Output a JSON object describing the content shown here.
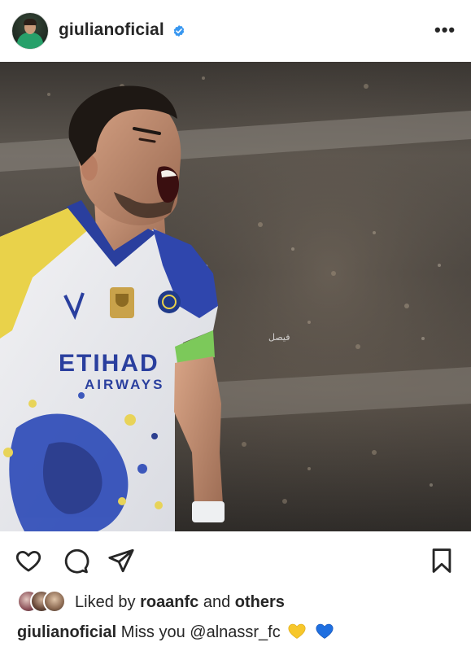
{
  "post": {
    "username": "giulianoficial",
    "verified": true,
    "more_icon": "more-horizontal-icon",
    "more_glyph": "•••"
  },
  "photo": {
    "watermark": "فيصل",
    "jersey_sponsor_top": "ETIHAD",
    "jersey_sponsor_bottom": "AIRWAYS",
    "colors": {
      "jersey_yellow": "#e9d24a",
      "jersey_blue": "#2a3f9e",
      "captain_band": "#7cc95a",
      "stadium": "#4e4a45"
    }
  },
  "actions": {
    "like_icon": "heart-icon",
    "comment_icon": "comment-icon",
    "share_icon": "share-icon",
    "save_icon": "bookmark-icon"
  },
  "likes": {
    "prefix": "Liked by ",
    "user": "roaanfc",
    "middle": " and ",
    "others": "others"
  },
  "caption": {
    "user": "giulianoficial",
    "text": " Miss you ",
    "mention": "@alnassr_fc",
    "emojis": [
      "yellow-heart",
      "blue-heart"
    ],
    "colors": {
      "yellow_heart": "#f7c72b",
      "blue_heart": "#1f6fe0",
      "verified": "#3897f0"
    }
  }
}
